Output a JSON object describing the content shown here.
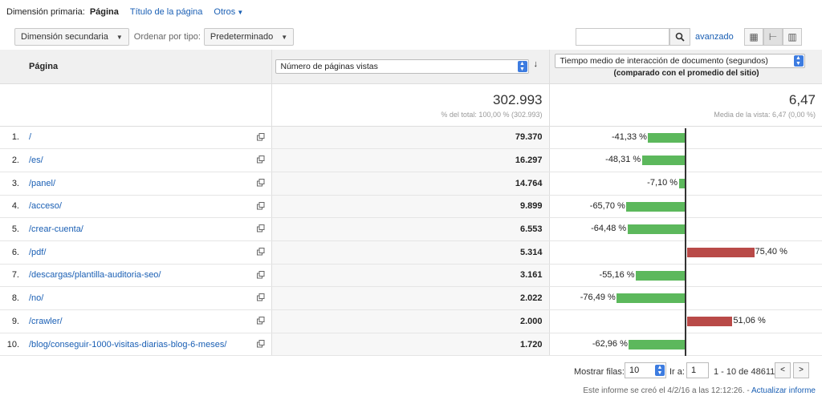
{
  "topbar": {
    "primary_label": "Dimensión primaria:",
    "active": "Página",
    "options": [
      "Título de la página",
      "Otros"
    ]
  },
  "controls": {
    "secondary_dim": "Dimensión secundaria",
    "order_label": "Ordenar por tipo:",
    "order_value": "Predeterminado",
    "search_placeholder": "",
    "advanced": "avanzado"
  },
  "header": {
    "col_page": "Página",
    "metric1": "Número de páginas vistas",
    "metric2": "Tiempo medio de interacción de documento (segundos)",
    "metric2_sub": "(comparado con el promedio del sitio)"
  },
  "summary": {
    "views_total": "302.993",
    "views_sub": "% del total: 100,00 % (302.993)",
    "avg_total": "6,47",
    "avg_sub": "Media de la vista: 6,47 (0,00 %)"
  },
  "rows": [
    {
      "n": "1.",
      "page": "/",
      "views": "79.370",
      "pct": "-41,33 %",
      "val": -41.33
    },
    {
      "n": "2.",
      "page": "/es/",
      "views": "16.297",
      "pct": "-48,31 %",
      "val": -48.31
    },
    {
      "n": "3.",
      "page": "/panel/",
      "views": "14.764",
      "pct": "-7,10 %",
      "val": -7.1
    },
    {
      "n": "4.",
      "page": "/acceso/",
      "views": "9.899",
      "pct": "-65,70 %",
      "val": -65.7
    },
    {
      "n": "5.",
      "page": "/crear-cuenta/",
      "views": "6.553",
      "pct": "-64,48 %",
      "val": -64.48
    },
    {
      "n": "6.",
      "page": "/pdf/",
      "views": "5.314",
      "pct": "75,40 %",
      "val": 75.4
    },
    {
      "n": "7.",
      "page": "/descargas/plantilla-auditoria-seo/",
      "views": "3.161",
      "pct": "-55,16 %",
      "val": -55.16
    },
    {
      "n": "8.",
      "page": "/no/",
      "views": "2.022",
      "pct": "-76,49 %",
      "val": -76.49
    },
    {
      "n": "9.",
      "page": "/crawler/",
      "views": "2.000",
      "pct": "51,06 %",
      "val": 51.06
    },
    {
      "n": "10.",
      "page": "/blog/conseguir-1000-visitas-diarias-blog-6-meses/",
      "views": "1.720",
      "pct": "-62,96 %",
      "val": -62.96
    }
  ],
  "footer": {
    "show_rows": "Mostrar filas:",
    "rows_value": "10",
    "goto": "Ir a:",
    "goto_value": "1",
    "range": "1 - 10 de 48611",
    "prev": "<",
    "next": ">",
    "note": "Este informe se creó el 4/2/16 a las 12:12:26. -",
    "update": "Actualizar informe"
  },
  "colors": {
    "negative": "#5cb85c",
    "positive": "#b94a48",
    "link": "#1a5fb4"
  }
}
